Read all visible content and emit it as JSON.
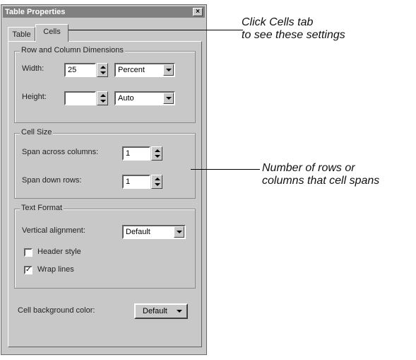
{
  "dialog": {
    "title": "Table Properties",
    "close_glyph": "×",
    "tabs": [
      "Table",
      "Cells"
    ]
  },
  "row_col_group": {
    "title": "Row and Column Dimensions",
    "width_label": "Width:",
    "width_value": "25",
    "width_unit": "Percent",
    "height_label": "Height:",
    "height_value": "",
    "height_unit": "Auto"
  },
  "cell_size_group": {
    "title": "Cell Size",
    "span_cols_label": "Span across columns:",
    "span_cols_value": "1",
    "span_rows_label": "Span down rows:",
    "span_rows_value": "1"
  },
  "text_format_group": {
    "title": "Text Format",
    "valign_label": "Vertical alignment:",
    "valign_value": "Default",
    "header_style_label": "Header style",
    "header_style_checked": false,
    "wrap_lines_label": "Wrap lines",
    "wrap_lines_checked": true
  },
  "background": {
    "label": "Cell background color:",
    "value": "Default"
  },
  "callouts": {
    "tab_line1": "Click Cells tab",
    "tab_line2": "to see these settings",
    "span_line1": "Number of rows or",
    "span_line2": "columns that cell spans"
  },
  "icons": {
    "close": "close-icon",
    "spinner": "spinner-icon",
    "dropdown": "chevron-down-icon",
    "check": "checkmark-icon"
  },
  "colors": {
    "dialog_bg": "#c8c8c8",
    "titlebar": "#808080"
  }
}
